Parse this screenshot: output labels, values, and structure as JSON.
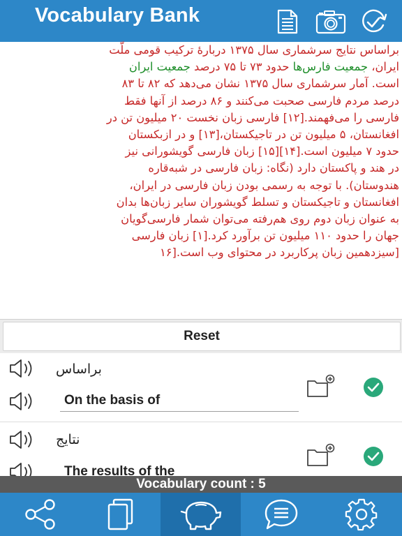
{
  "header": {
    "title": "Vocabulary Bank",
    "icons": [
      "document-icon",
      "camera-icon",
      "history-check-icon"
    ]
  },
  "passage": {
    "lines": [
      {
        "parts": [
          {
            "t": "براساس نتایج سرشماری سال ۱۳۷۵ دربارهٔ ترکیب قومی ملّت",
            "hl": false
          }
        ]
      },
      {
        "parts": [
          {
            "t": "ایران، ",
            "hl": false
          },
          {
            "t": "جمعیت فارس‌ها",
            "hl": true
          },
          {
            "t": " حدود ۷۳ تا ۷۵ درصد ",
            "hl": false
          },
          {
            "t": "جمعیت ایران",
            "hl": true
          }
        ]
      },
      {
        "parts": [
          {
            "t": "است. آمار سرشماری سال ۱۳۷۵ نشان می‌دهد که ۸۲ تا ۸۳",
            "hl": false
          }
        ]
      },
      {
        "parts": [
          {
            "t": "درصد مردم فارسی صحبت می‌کنند و ۸۶ درصد از آنها فقط",
            "hl": false
          }
        ]
      },
      {
        "parts": [
          {
            "t": "فارسی را می‌فهمند.[۱۲] فارسی زبان نخست ۲۰ میلیون تن در",
            "hl": false
          }
        ]
      },
      {
        "parts": [
          {
            "t": "افغانستان، ۵ میلیون تن در تاجیکستان،[۱۳] و در ازبکستان",
            "hl": false
          }
        ]
      },
      {
        "parts": [
          {
            "t": "حدود ۷ میلیون است.[۱۴][۱۵] زبان فارسی گویشورانی نیز",
            "hl": false
          }
        ]
      },
      {
        "parts": [
          {
            "t": "در هند و پاکستان دارد (نگاه: زبان فارسی در شبه‌قاره",
            "hl": false
          }
        ]
      },
      {
        "parts": [
          {
            "t": "هندوستان). با توجه به رسمی بودن زبان فارسی در ایران،",
            "hl": false
          }
        ]
      },
      {
        "parts": [
          {
            "t": "افغانستان و تاجیکستان و تسلط گویشوران سایر زبان‌ها بدان",
            "hl": false
          }
        ]
      },
      {
        "parts": [
          {
            "t": "به عنوان زبان دوم روی هم‌رفته می‌توان شمار فارسی‌گویان",
            "hl": false
          }
        ]
      },
      {
        "parts": [
          {
            "t": "جهان را حدود ۱۱۰ میلیون تن برآورد کرد.[۱] زبان فارسی",
            "hl": false
          }
        ]
      },
      {
        "parts": [
          {
            "t": "[سیزدهمین زبان پرکاربرد در محتوای وب است.[۱۶",
            "hl": false
          }
        ]
      }
    ]
  },
  "reset_label": "Reset",
  "vocab_items": [
    {
      "persian": "براساس",
      "translation": "On the basis of"
    },
    {
      "persian": "نتایج",
      "translation": "The results of the"
    }
  ],
  "footer": {
    "count_text": "Vocabulary count : 5"
  },
  "tabs": [
    {
      "name": "tab-share",
      "icon": "share-icon"
    },
    {
      "name": "tab-pages",
      "icon": "copy-pages-icon"
    },
    {
      "name": "tab-vocabulary",
      "icon": "piggy-bank-icon",
      "active": true
    },
    {
      "name": "tab-messages",
      "icon": "chat-list-icon"
    },
    {
      "name": "tab-settings",
      "icon": "gear-icon"
    }
  ],
  "colors": {
    "brand": "#2d87c8",
    "active_tab": "#1f6fab",
    "passage_text": "#c62828",
    "highlight_text": "#1e8e2a",
    "check": "#2aa87a"
  }
}
